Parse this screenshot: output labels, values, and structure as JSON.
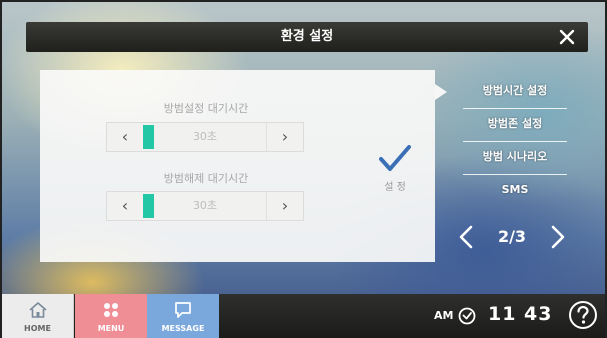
{
  "header": {
    "title": "환경 설정"
  },
  "panel": {
    "arm_delay": {
      "label": "방범설정 대기시간",
      "value": "30초",
      "level": 0.09
    },
    "disarm_delay": {
      "label": "방범해제 대기시간",
      "value": "30초",
      "level": 0.09
    },
    "confirm_label": "설 정"
  },
  "menu": {
    "items": [
      {
        "label": "방범시간 설정",
        "selected": true
      },
      {
        "label": "방범존 설정",
        "selected": false
      },
      {
        "label": "방범 시나리오",
        "selected": false
      },
      {
        "label": "SMS",
        "selected": false
      }
    ]
  },
  "pager": {
    "page": "2/3"
  },
  "bottom_nav": {
    "home": "HOME",
    "menu": "MENU",
    "message": "MESSAGE"
  },
  "clock": {
    "ampm": "AM",
    "time": "11 43"
  },
  "colors": {
    "accent": "#22c7a5",
    "check": "#3a6fb5",
    "menu_button": "#f08e95",
    "message_button": "#7aa8dc"
  },
  "icons": {
    "close": "close-icon",
    "check": "checkmark-icon",
    "home": "home-icon",
    "menu": "grid-dots-icon",
    "message": "speech-bubble-icon",
    "clock": "clock-icon",
    "help": "question-icon"
  }
}
